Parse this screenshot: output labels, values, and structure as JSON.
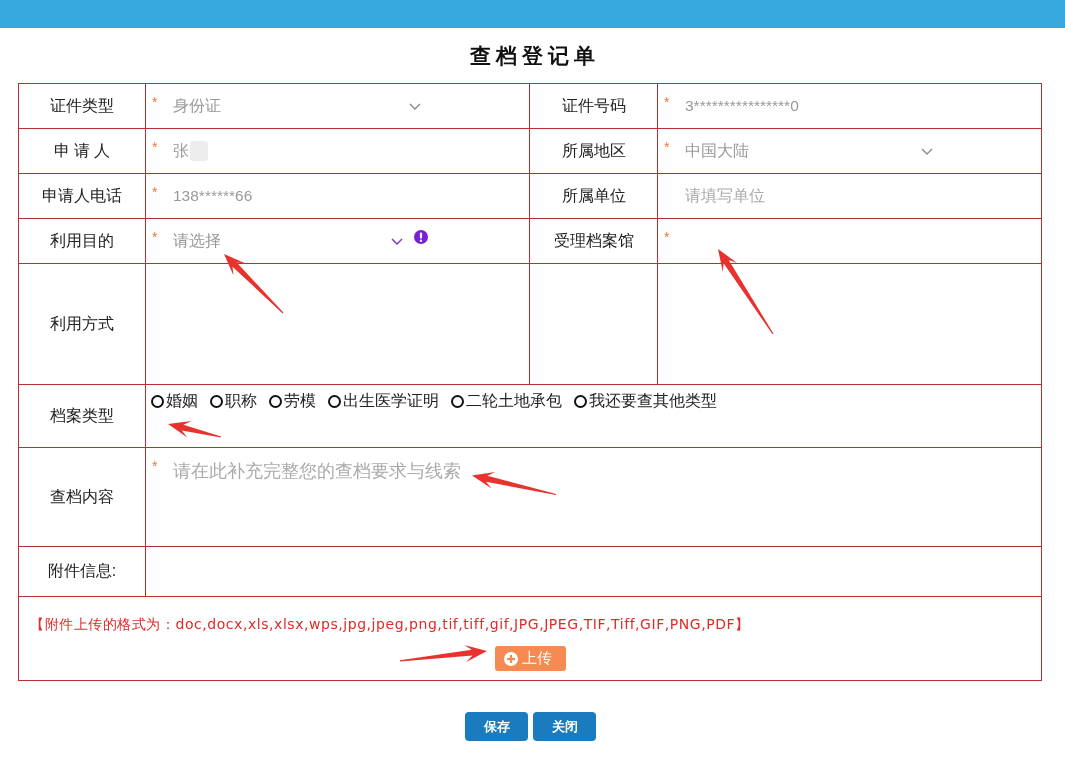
{
  "title": "查档登记单",
  "fields": [
    {
      "label": "证件类型",
      "kind": "select",
      "marker": "*",
      "value": "身份证"
    },
    {
      "label": "证件号码",
      "kind": "text",
      "marker": "*",
      "value": "3****************0"
    },
    {
      "label": "申 请 人",
      "kind": "text",
      "marker": "*",
      "value": "张",
      "redacted": true
    },
    {
      "label": "所属地区",
      "kind": "select",
      "marker": "*",
      "value": "中国大陆"
    },
    {
      "label": "申请人电话",
      "kind": "text",
      "marker": "*",
      "value": "138******66"
    },
    {
      "label": "所属单位",
      "kind": "text",
      "placeholder": "请填写单位"
    },
    {
      "label": "利用目的",
      "kind": "select",
      "marker": "*",
      "placeholder": "请选择",
      "invalid": true
    },
    {
      "label": "受理档案馆",
      "kind": "text",
      "marker": "*"
    }
  ],
  "usage_method": {
    "label": "利用方式"
  },
  "archive_types": {
    "label": "档案类型",
    "options": [
      {
        "label": "婚姻",
        "selected": false
      },
      {
        "label": "职称",
        "selected": false
      },
      {
        "label": "劳模",
        "selected": false
      },
      {
        "label": "出生医学证明",
        "selected": false
      },
      {
        "label": "二轮土地承包",
        "selected": false
      },
      {
        "label": "我还要查其他类型",
        "selected": false
      }
    ]
  },
  "content": {
    "label": "查档内容",
    "marker": "*",
    "placeholder": "请在此补充完整您的查档要求与线索"
  },
  "attachments": {
    "label": "附件信息:"
  },
  "upload": {
    "note": "【附件上传的格式为：doc,docx,xls,xlsx,wps,jpg,jpeg,png,tif,tiff,gif,JPG,JPEG,TIF,Tiff,GIF,PNG,PDF】",
    "button": "上传"
  },
  "buttons": [
    "保存",
    "关闭"
  ]
}
